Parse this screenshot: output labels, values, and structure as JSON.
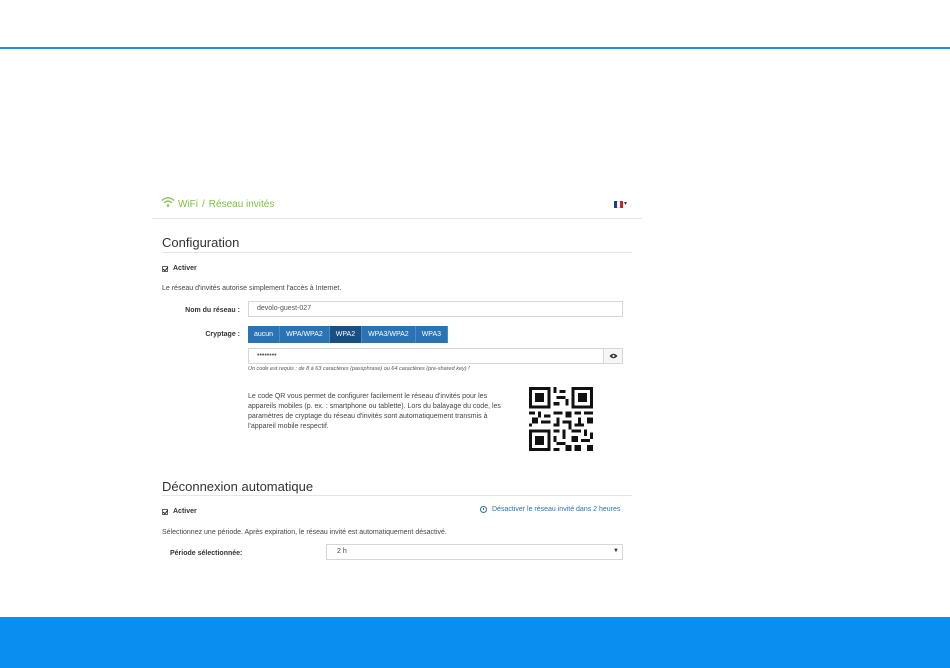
{
  "breadcrumb": {
    "root": "WiFi",
    "separator": "/",
    "current": "Réseau invités"
  },
  "flag": {
    "colors": [
      "#1f3a93",
      "#ffffff",
      "#d0202e"
    ]
  },
  "configuration": {
    "title": "Configuration",
    "activate_label": "Activer",
    "description": "Le réseau d'invités autorise simplement l'accès à Internet.",
    "network_name_label": "Nom du réseau :",
    "network_name_value": "devolo-guest-027",
    "encryption_label": "Cryptage :",
    "encryption_options": [
      "aucun",
      "WPA/WPA2",
      "WPA2",
      "WPA3/WPA2",
      "WPA3"
    ],
    "encryption_selected": "WPA2",
    "password_value": "••••••••",
    "password_hint": "Un code est requis : de 8 à 63 caractères (passphrase) ou 64 caractères (pre-shared key) !",
    "qr_text": "Le code QR vous permet de configurer facilement le réseau d'invités pour les appareils mobiles (p. ex. : smartphone ou tablette). Lors du balayage du code, les paramètres de cryptage du réseau d'invités sont automatiquement transmis à l'appareil mobile respectif."
  },
  "auto_disconnect": {
    "title": "Déconnexion automatique",
    "activate_label": "Activer",
    "timer_link": "Désactiver le réseau invité dans 2 heures",
    "description": "Sélectionnez une période. Après expiration, le réseau invité est automatiquement désactivé.",
    "period_label": "Période sélectionnée:",
    "period_value": "2 h"
  },
  "colors": {
    "accent_green": "#7cc142",
    "button_blue": "#2c73b3",
    "button_active": "#1a4f82",
    "brand_blue": "#0a8ef0"
  }
}
